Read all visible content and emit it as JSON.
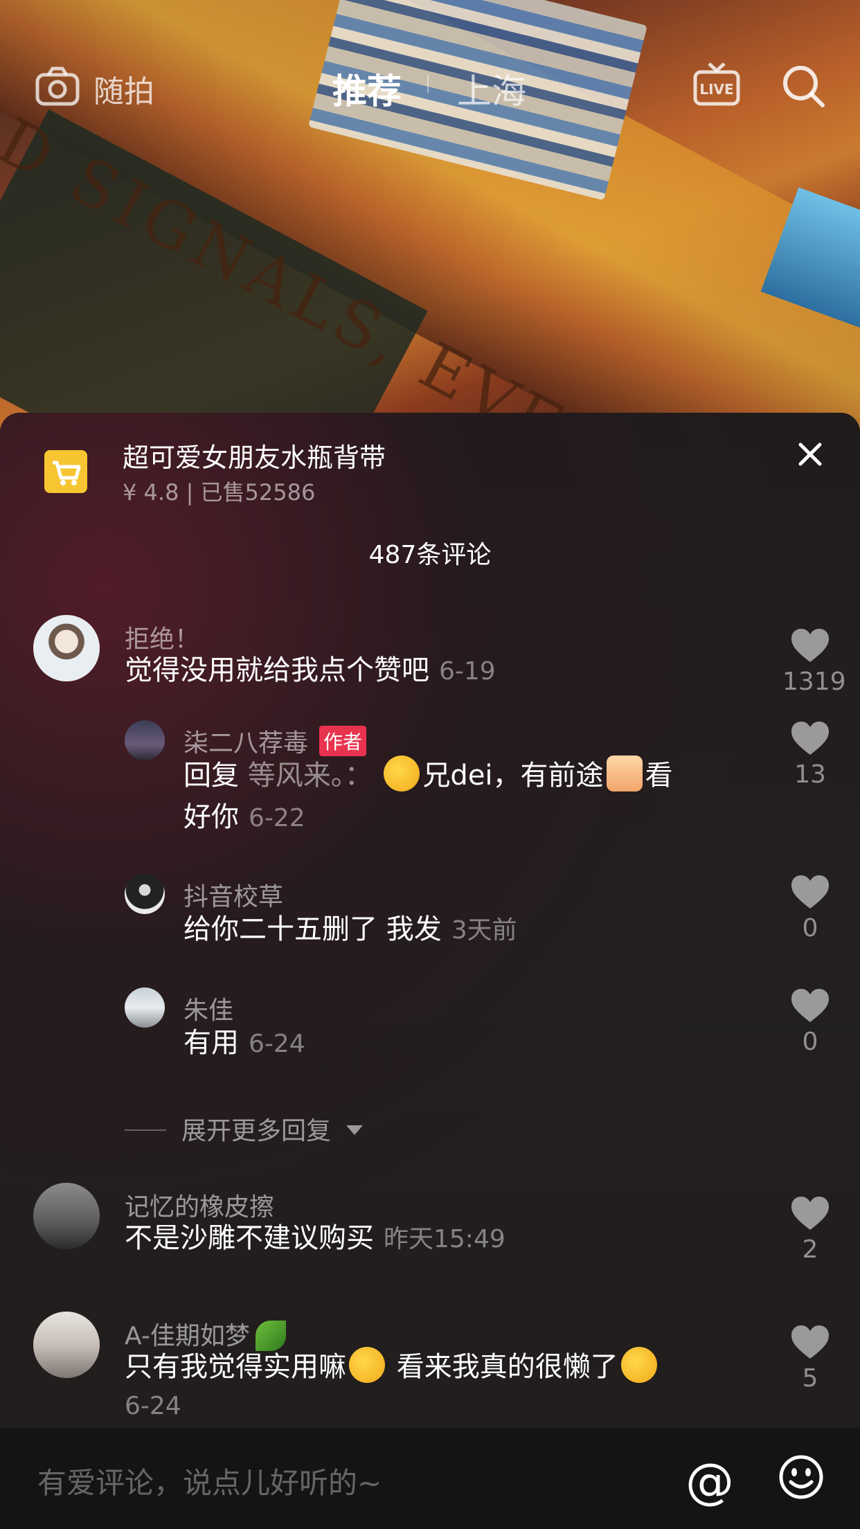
{
  "video": {
    "engraved_text": "D SIGNALS, EVEN IF"
  },
  "topbar": {
    "camera_label": "随拍",
    "tab_active": "推荐",
    "tab_other": "上海",
    "live_icon_text": "LIVE"
  },
  "product": {
    "title": "超可爱女朋友水瓶背带",
    "meta": "¥ 4.8  |  已售52586"
  },
  "comment_count": "487条评论",
  "comments": [
    {
      "user": "拒绝！",
      "text": "觉得没用就给我点个赞吧",
      "time": "6-19",
      "likes": "1319"
    },
    {
      "user": "柒二八荐毒",
      "tag": "作者",
      "reply_prefix": "回复 ",
      "reply_to": "等风来。：",
      "text_a": "兄dei，有前途",
      "text_b": "看",
      "text_c": "好你",
      "time": "6-22",
      "likes": "13"
    },
    {
      "user": "抖音校草",
      "text": "给你二十五删了 我发",
      "time": "3天前",
      "likes": "0"
    },
    {
      "user": "朱佳",
      "text": "有用",
      "time": "6-24",
      "likes": "0"
    },
    {
      "user": "记忆的橡皮擦",
      "text": "不是沙雕不建议购买",
      "time": "昨天15:49",
      "likes": "2"
    },
    {
      "user": "A-佳期如梦",
      "text_a": "只有我觉得实用嘛",
      "text_b": " 看来我真的很懒了",
      "time": "6-24",
      "likes": "5"
    }
  ],
  "expand_label": "展开更多回复",
  "input": {
    "placeholder": "有爱评论，说点儿好听的~"
  },
  "icons": {
    "camera": "camera-icon",
    "live": "live-icon",
    "search": "search-icon",
    "cart": "cart-icon",
    "close": "close-icon",
    "heart": "heart-icon",
    "at": "at-icon",
    "smile": "smile-icon"
  },
  "colors": {
    "author_tag": "#e8334f",
    "cart_badge": "#f6c531"
  }
}
